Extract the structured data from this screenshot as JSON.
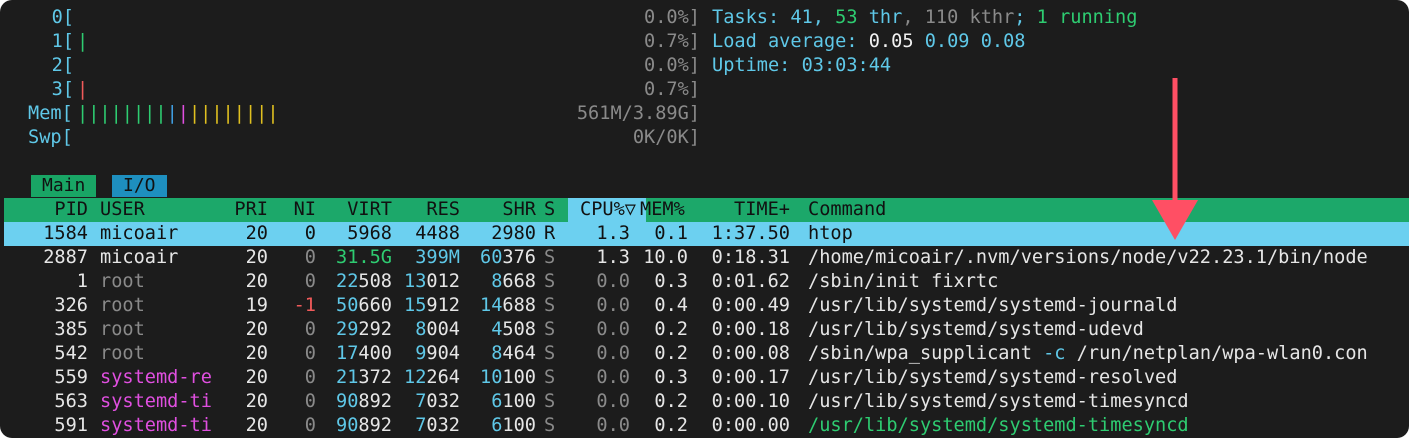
{
  "meters": {
    "cpus": [
      {
        "label": "0[",
        "value": "0.0%]",
        "bar": "",
        "bar_color": "#2ecc71"
      },
      {
        "label": "1[",
        "value": "0.7%]",
        "bar": "|",
        "bar_color": "#2ecc71"
      },
      {
        "label": "2[",
        "value": "0.0%]",
        "bar": "",
        "bar_color": "#2ecc71"
      },
      {
        "label": "3[",
        "value": "0.7%]",
        "bar": "|",
        "bar_color": "#f05a5a"
      }
    ],
    "mem": {
      "label": "Mem[",
      "value": "561M/3.89G]"
    },
    "swp": {
      "label": "Swp[",
      "value": "0K/0K]"
    }
  },
  "summary": {
    "tasks_label": "Tasks: ",
    "tasks_count": "41",
    "sep1": ", ",
    "thr_count": "53",
    "thr_label": " thr",
    "kthr": ", 110 kthr",
    "sep2": "; ",
    "running_count": "1",
    "running_label": " running",
    "load_label": "Load average: ",
    "load1": "0.05",
    "load5": "0.09",
    "load15": "0.08",
    "uptime_label": "Uptime: ",
    "uptime": "03:03:44"
  },
  "tabs": {
    "main": "Main",
    "io": "I/O"
  },
  "columns": {
    "pid": "PID",
    "user": "USER",
    "pri": "PRI",
    "ni": "NI",
    "virt": "VIRT",
    "res": "RES",
    "shr": "SHR",
    "s": "S",
    "cpu": "CPU%▽",
    "mem": "MEM%",
    "time": "TIME+",
    "command": "Command"
  },
  "processes": [
    {
      "pid": "1584",
      "user": "micoair",
      "pri": "20",
      "ni": "0",
      "virt": "5968",
      "res": "4488",
      "shr": "2980",
      "s": "R",
      "cpu": "1.3",
      "mem": "0.1",
      "time": "1:37.50",
      "command": "htop"
    },
    {
      "pid": "2887",
      "user": "micoair",
      "pri": "20",
      "ni": "0",
      "virt": "31.5G",
      "res": "399M",
      "shr": "60376",
      "s": "S",
      "cpu": "1.3",
      "mem": "10.0",
      "time": "0:18.31",
      "command": "/home/micoair/.nvm/versions/node/v22.23.1/bin/node"
    },
    {
      "pid": "1",
      "user": "root",
      "pri": "20",
      "ni": "0",
      "virt": "22508",
      "res": "13012",
      "shr": "8668",
      "s": "S",
      "cpu": "0.0",
      "mem": "0.3",
      "time": "0:01.62",
      "command": "/sbin/init fixrtc"
    },
    {
      "pid": "326",
      "user": "root",
      "pri": "19",
      "ni": "-1",
      "virt": "50660",
      "res": "15912",
      "shr": "14688",
      "s": "S",
      "cpu": "0.0",
      "mem": "0.4",
      "time": "0:00.49",
      "command": "/usr/lib/systemd/systemd-journald"
    },
    {
      "pid": "385",
      "user": "root",
      "pri": "20",
      "ni": "0",
      "virt": "29292",
      "res": "8004",
      "shr": "4508",
      "s": "S",
      "cpu": "0.0",
      "mem": "0.2",
      "time": "0:00.18",
      "command": "/usr/lib/systemd/systemd-udevd"
    },
    {
      "pid": "542",
      "user": "root",
      "pri": "20",
      "ni": "0",
      "virt": "17400",
      "res": "9904",
      "shr": "8464",
      "s": "S",
      "cpu": "0.0",
      "mem": "0.2",
      "time": "0:00.08",
      "command": "/sbin/wpa_supplicant -c /run/netplan/wpa-wlan0.con"
    },
    {
      "pid": "559",
      "user": "systemd-re",
      "pri": "20",
      "ni": "0",
      "virt": "21372",
      "res": "12264",
      "shr": "10100",
      "s": "S",
      "cpu": "0.0",
      "mem": "0.3",
      "time": "0:00.17",
      "command": "/usr/lib/systemd/systemd-resolved"
    },
    {
      "pid": "563",
      "user": "systemd-ti",
      "pri": "20",
      "ni": "0",
      "virt": "90892",
      "res": "7032",
      "shr": "6100",
      "s": "S",
      "cpu": "0.0",
      "mem": "0.2",
      "time": "0:00.10",
      "command": "/usr/lib/systemd/systemd-timesyncd"
    },
    {
      "pid": "591",
      "user": "systemd-ti",
      "pri": "20",
      "ni": "0",
      "virt": "90892",
      "res": "7032",
      "shr": "6100",
      "s": "S",
      "cpu": "0.0",
      "mem": "0.2",
      "time": "0:00.00",
      "command": "/usr/lib/systemd/systemd-timesyncd"
    }
  ],
  "annotation": {
    "icon": "down-arrow-icon",
    "color": "#ff4f64"
  }
}
